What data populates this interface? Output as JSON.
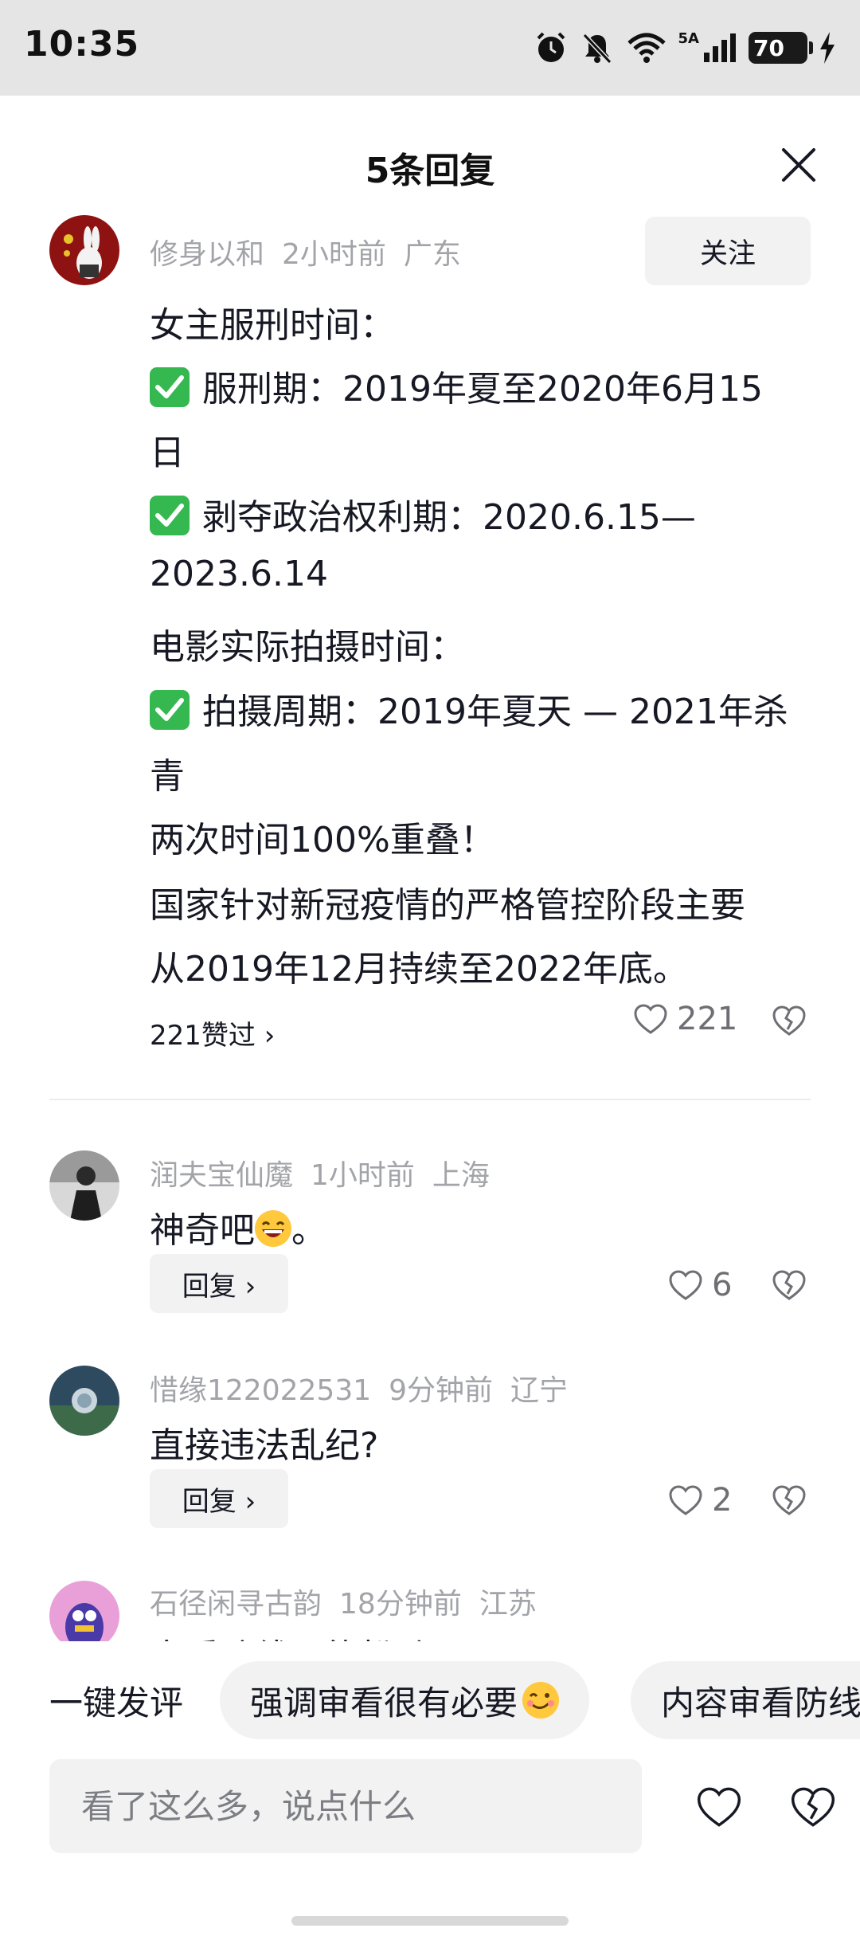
{
  "status_bar": {
    "time": "10:35",
    "network_label": "5A",
    "battery": "70"
  },
  "header": {
    "title": "5条回复"
  },
  "main_comment": {
    "username": "修身以和",
    "time": "2小时前",
    "location": "广东",
    "follow_label": "关注",
    "lines": [
      "女主服刑时间：",
      "服刑期：2019年夏至2020年6月15",
      "日",
      "剥夺政治权利期：2020.6.15—",
      "2023.6.14",
      " 电影实际拍摄时间：",
      "拍摄周期：2019年夏天 — 2021年杀",
      "青",
      " 两次时间100%重叠！",
      " 国家针对新冠疫情的严格管控阶段主要",
      "从2019年12月持续至2022年底。"
    ],
    "likes_link": "221赞过 ›",
    "like_count": "221"
  },
  "replies": [
    {
      "username": "润夫宝仙魔",
      "time": "1小时前",
      "location": "上海",
      "text": "神奇吧",
      "text_suffix": "。",
      "reply_label": "回复 ›",
      "like_count": "6"
    },
    {
      "username": "惜缘122022531",
      "time": "9分钟前",
      "location": "辽宁",
      "text": "直接违法乱纪?",
      "reply_label": "回复 ›",
      "like_count": "2"
    },
    {
      "username": "石径闲寻古韵",
      "time": "18分钟前",
      "location": "江苏",
      "text": "审看防线不能松动呀"
    }
  ],
  "quick_comments": {
    "label": "一键发评",
    "chips": [
      "强调审看很有必要",
      "内容审看防线"
    ]
  },
  "input": {
    "placeholder": "看了这么多，说点什么"
  }
}
